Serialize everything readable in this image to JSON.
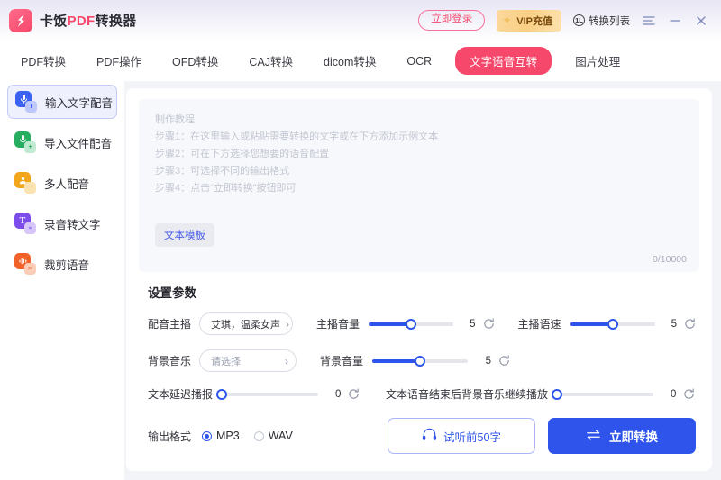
{
  "titlebar": {
    "logo_icon": "card-pdf-logo-icon",
    "brand_prefix": "卡饭",
    "brand_mid": "PDF",
    "brand_suffix": "转换器",
    "login_label": "立即登录",
    "vip_label": "VIP充值",
    "vip_icon": "crown-icon",
    "conversion_list_label": "转换列表",
    "conversion_list_count": "1L",
    "menu_icon": "menu-lines-icon",
    "minimize_icon": "minimize-icon",
    "close_icon": "close-icon"
  },
  "nav_tabs": [
    {
      "label": "PDF转换",
      "active": false
    },
    {
      "label": "PDF操作",
      "active": false
    },
    {
      "label": "OFD转换",
      "active": false
    },
    {
      "label": "CAJ转换",
      "active": false
    },
    {
      "label": "dicom转换",
      "active": false
    },
    {
      "label": "OCR",
      "active": false
    },
    {
      "label": "文字语音互转",
      "active": true
    },
    {
      "label": "图片处理",
      "active": false
    }
  ],
  "sidebar": {
    "items": [
      {
        "label": "输入文字配音",
        "icon": "microphone-text-icon",
        "main_color": "#3b62f0",
        "sub_color": "#bcc8fa",
        "glyph": "mic",
        "badge": "T",
        "active": true
      },
      {
        "label": "导入文件配音",
        "icon": "microphone-file-icon",
        "main_color": "#27ad5f",
        "sub_color": "#bfe9d0",
        "glyph": "mic",
        "badge": "+",
        "active": false
      },
      {
        "label": "多人配音",
        "icon": "multi-speaker-icon",
        "main_color": "#f1a61c",
        "sub_color": "#fbe2b1",
        "glyph": "people",
        "badge": "",
        "active": false
      },
      {
        "label": "录音转文字",
        "icon": "audio-to-text-icon",
        "main_color": "#7c4dea",
        "sub_color": "#d6c6fa",
        "glyph": "T",
        "badge": "w",
        "active": false
      },
      {
        "label": "裁剪语音",
        "icon": "trim-audio-icon",
        "main_color": "#f0622a",
        "sub_color": "#fbccb6",
        "glyph": "wave",
        "badge": "c",
        "active": false
      }
    ]
  },
  "editor": {
    "placeholder_lines": [
      "制作教程",
      "步骤1：在这里输入或粘贴需要转换的文字或在下方添加示例文本",
      "步骤2：可在下方选择您想要的语音配置",
      "步骤3：可选择不同的输出格式",
      "步骤4：点击“立即转换”按钮即可"
    ],
    "value": "",
    "template_button": "文本模板",
    "counter": "0/10000"
  },
  "settings": {
    "title": "设置参数",
    "voice": {
      "label": "配音主播",
      "value": "艾琪，温柔女声",
      "chevron_icon": "chevron-right-icon"
    },
    "voice_volume": {
      "label": "主播音量",
      "value": "5",
      "percent": 50,
      "reset_icon": "reset-icon"
    },
    "voice_speed": {
      "label": "主播语速",
      "value": "5",
      "percent": 50,
      "reset_icon": "reset-icon"
    },
    "bgm": {
      "label": "背景音乐",
      "value": "请选择",
      "is_placeholder": true,
      "chevron_icon": "chevron-right-icon"
    },
    "bgm_volume": {
      "label": "背景音量",
      "value": "5",
      "percent": 50,
      "reset_icon": "reset-icon"
    },
    "text_delay": {
      "label": "文本延迟播报",
      "value": "0",
      "percent": 0,
      "reset_icon": "reset-icon"
    },
    "bgm_continue": {
      "label": "文本语音结束后背景音乐继续播放",
      "value": "0",
      "percent": 0,
      "reset_icon": "reset-icon"
    },
    "output_format": {
      "label": "输出格式",
      "options": [
        {
          "label": "MP3",
          "selected": true
        },
        {
          "label": "WAV",
          "selected": false
        }
      ]
    },
    "preview_button": {
      "label": "试听前50字",
      "icon": "headphones-icon"
    },
    "convert_button": {
      "label": "立即转换",
      "icon": "convert-arrows-icon"
    }
  },
  "colors": {
    "accent_pink": "#f5486b",
    "accent_blue": "#2f54eb",
    "panel_bg": "#f2f4f8",
    "editor_bg": "#f7f8fb"
  }
}
